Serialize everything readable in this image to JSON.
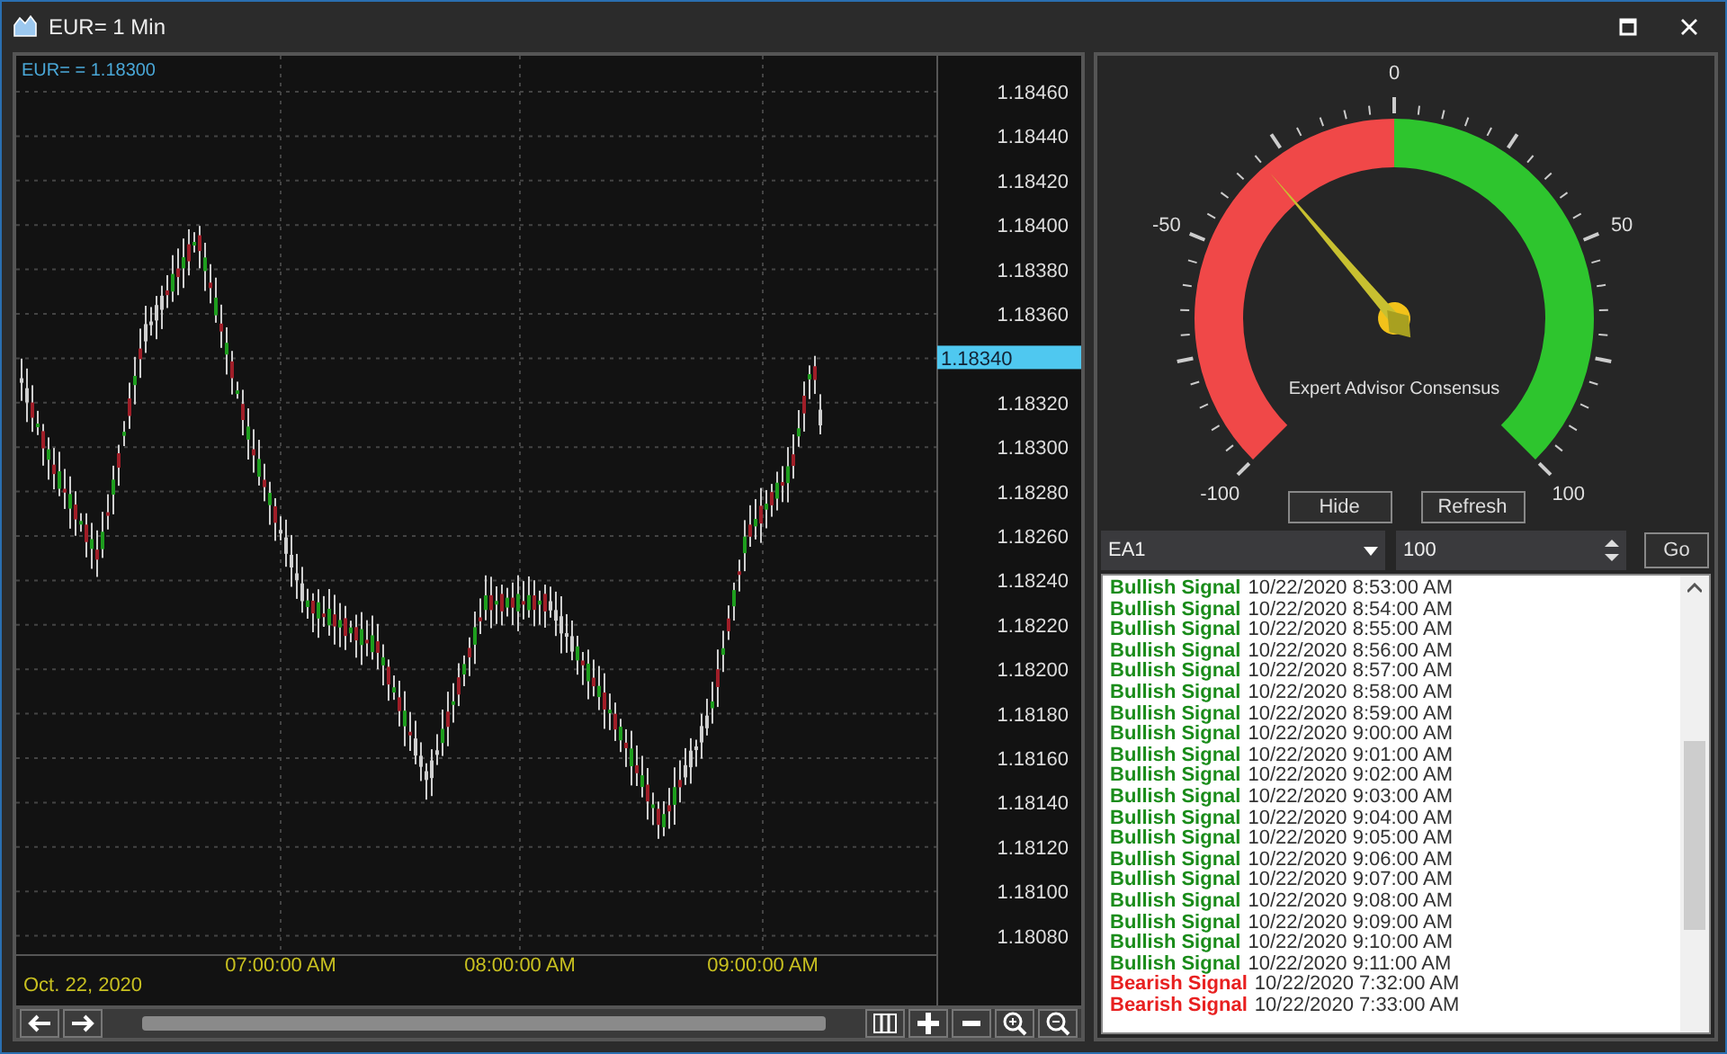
{
  "window": {
    "title": "EUR= 1 Min"
  },
  "chart": {
    "legend": "EUR= = 1.18300",
    "price_labels": [
      "1.18460",
      "1.18440",
      "1.18420",
      "1.18400",
      "1.18380",
      "1.18360",
      "1.18320",
      "1.18300",
      "1.18280",
      "1.18260",
      "1.18240",
      "1.18220",
      "1.18200",
      "1.18180",
      "1.18160",
      "1.18140",
      "1.18120",
      "1.18100",
      "1.18080"
    ],
    "current_price": "1.18340",
    "time_labels": [
      "07:00:00 AM",
      "08:00:00 AM",
      "09:00:00 AM"
    ],
    "date_label": "Oct. 22, 2020"
  },
  "gauge": {
    "title": "Expert Advisor Consensus",
    "scale_labels": [
      "-100",
      "-50",
      "0",
      "50",
      "100"
    ],
    "level": 0.35,
    "buttons": [
      "Hide",
      "Refresh"
    ]
  },
  "controls": {
    "advisor": "EA1",
    "count": "100",
    "go": "Go"
  },
  "signals": [
    {
      "kind": "bullish",
      "label": "Bullish Signal",
      "time": "10/22/2020 8:53:00 AM"
    },
    {
      "kind": "bullish",
      "label": "Bullish Signal",
      "time": "10/22/2020 8:54:00 AM"
    },
    {
      "kind": "bullish",
      "label": "Bullish Signal",
      "time": "10/22/2020 8:55:00 AM"
    },
    {
      "kind": "bullish",
      "label": "Bullish Signal",
      "time": "10/22/2020 8:56:00 AM"
    },
    {
      "kind": "bullish",
      "label": "Bullish Signal",
      "time": "10/22/2020 8:57:00 AM"
    },
    {
      "kind": "bullish",
      "label": "Bullish Signal",
      "time": "10/22/2020 8:58:00 AM"
    },
    {
      "kind": "bullish",
      "label": "Bullish Signal",
      "time": "10/22/2020 8:59:00 AM"
    },
    {
      "kind": "bullish",
      "label": "Bullish Signal",
      "time": "10/22/2020 9:00:00 AM"
    },
    {
      "kind": "bullish",
      "label": "Bullish Signal",
      "time": "10/22/2020 9:01:00 AM"
    },
    {
      "kind": "bullish",
      "label": "Bullish Signal",
      "time": "10/22/2020 9:02:00 AM"
    },
    {
      "kind": "bullish",
      "label": "Bullish Signal",
      "time": "10/22/2020 9:03:00 AM"
    },
    {
      "kind": "bullish",
      "label": "Bullish Signal",
      "time": "10/22/2020 9:04:00 AM"
    },
    {
      "kind": "bullish",
      "label": "Bullish Signal",
      "time": "10/22/2020 9:05:00 AM"
    },
    {
      "kind": "bullish",
      "label": "Bullish Signal",
      "time": "10/22/2020 9:06:00 AM"
    },
    {
      "kind": "bullish",
      "label": "Bullish Signal",
      "time": "10/22/2020 9:07:00 AM"
    },
    {
      "kind": "bullish",
      "label": "Bullish Signal",
      "time": "10/22/2020 9:08:00 AM"
    },
    {
      "kind": "bullish",
      "label": "Bullish Signal",
      "time": "10/22/2020 9:09:00 AM"
    },
    {
      "kind": "bullish",
      "label": "Bullish Signal",
      "time": "10/22/2020 9:10:00 AM"
    },
    {
      "kind": "bullish",
      "label": "Bullish Signal",
      "time": "10/22/2020 9:11:00 AM"
    },
    {
      "kind": "bearish",
      "label": "Bearish Signal",
      "time": "10/22/2020 7:32:00 AM"
    },
    {
      "kind": "bearish",
      "label": "Bearish Signal",
      "time": "10/22/2020 7:33:00 AM"
    }
  ]
}
